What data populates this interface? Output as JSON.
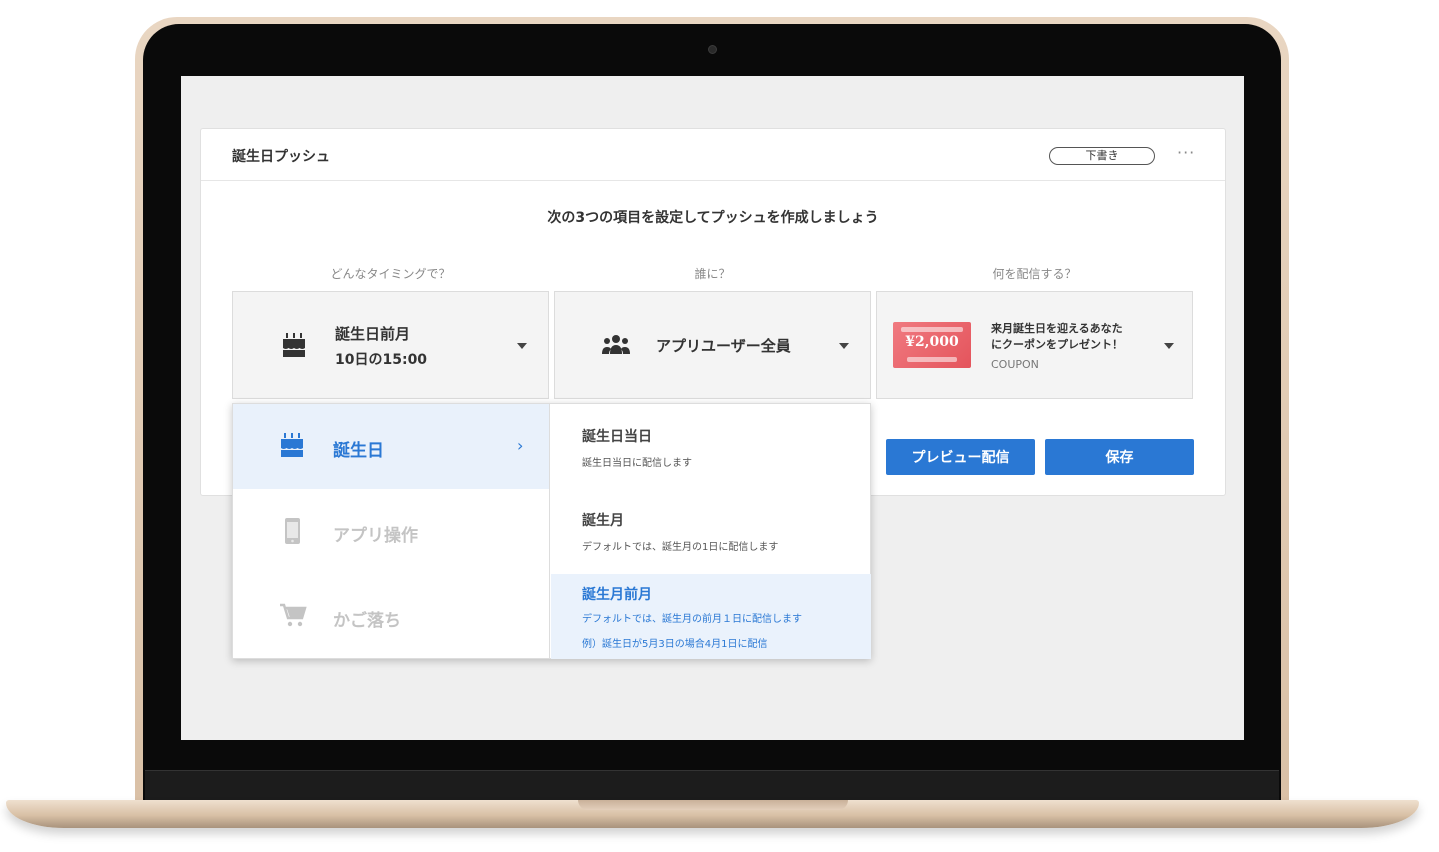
{
  "card": {
    "title": "誕生日プッシュ",
    "status": "下書き",
    "more": "···",
    "instruction": "次の3つの項目を設定してプッシュを作成しましょう"
  },
  "timing": {
    "label": "どんなタイミングで？",
    "line1": "誕生日前月",
    "line2": "10日の15:00",
    "icon": "birthday-cake-icon"
  },
  "audience": {
    "label": "誰に？",
    "value": "アプリユーザー全員",
    "icon": "users-icon"
  },
  "content": {
    "label": "何を配信する？",
    "title_line1": "来月誕生日を迎えるあなた",
    "title_line2": "にクーポンをプレゼント！",
    "type": "COUPON",
    "thumb_amount": "¥2,000"
  },
  "buttons": {
    "preview": "プレビュー配信",
    "save": "保存"
  },
  "dropdown": {
    "categories": [
      {
        "label": "誕生日",
        "icon": "birthday-cake-icon",
        "active": true
      },
      {
        "label": "アプリ操作",
        "icon": "smartphone-icon",
        "active": false
      },
      {
        "label": "かご落ち",
        "icon": "shopping-cart-icon",
        "active": false
      }
    ],
    "options": [
      {
        "title": "誕生日当日",
        "desc1": "誕生日当日に配信します"
      },
      {
        "title": "誕生月",
        "desc1": "デフォルトでは、誕生月の1日に配信します"
      },
      {
        "title": "誕生月前月",
        "desc1": "デフォルトでは、誕生月の前月１日に配信します",
        "desc2": "例）誕生日が5月3日の場合4月1日に配信"
      }
    ]
  },
  "colors": {
    "accent": "#2a78d4",
    "inactive": "#c4c4c4"
  }
}
